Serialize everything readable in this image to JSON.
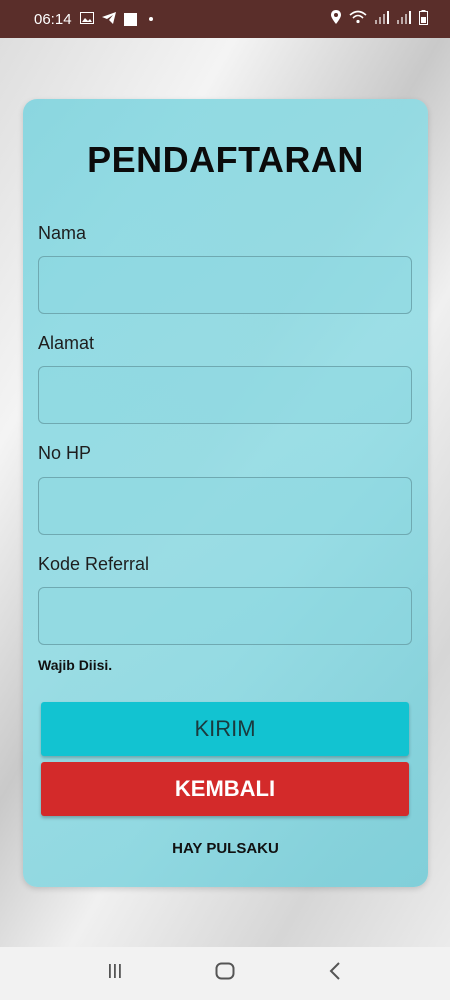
{
  "status_bar": {
    "time": "06:14"
  },
  "form": {
    "title": "PENDAFTARAN",
    "fields": [
      {
        "label": "Nama",
        "value": "",
        "placeholder": ""
      },
      {
        "label": "Alamat",
        "value": "",
        "placeholder": ""
      },
      {
        "label": "No HP",
        "value": "",
        "placeholder": ""
      },
      {
        "label": "Kode Referral",
        "value": "",
        "placeholder": ""
      }
    ],
    "required_note": "Wajib Diisi.",
    "submit_label": "KIRIM",
    "back_label": "KEMBALI",
    "footer": "HAY PULSAKU"
  },
  "colors": {
    "status_bar": "#5a2e2a",
    "card": "#8dd8e1",
    "submit_button": "#12c3d1",
    "back_button": "#d32a2a"
  },
  "icons": {
    "status_left": [
      "image-icon",
      "telegram-icon",
      "square-icon",
      "dot-icon"
    ],
    "status_right": [
      "location-icon",
      "wifi-icon",
      "signal-icon",
      "signal-icon",
      "battery-icon"
    ],
    "navigation": [
      "recent-apps-icon",
      "home-icon",
      "back-icon"
    ]
  }
}
